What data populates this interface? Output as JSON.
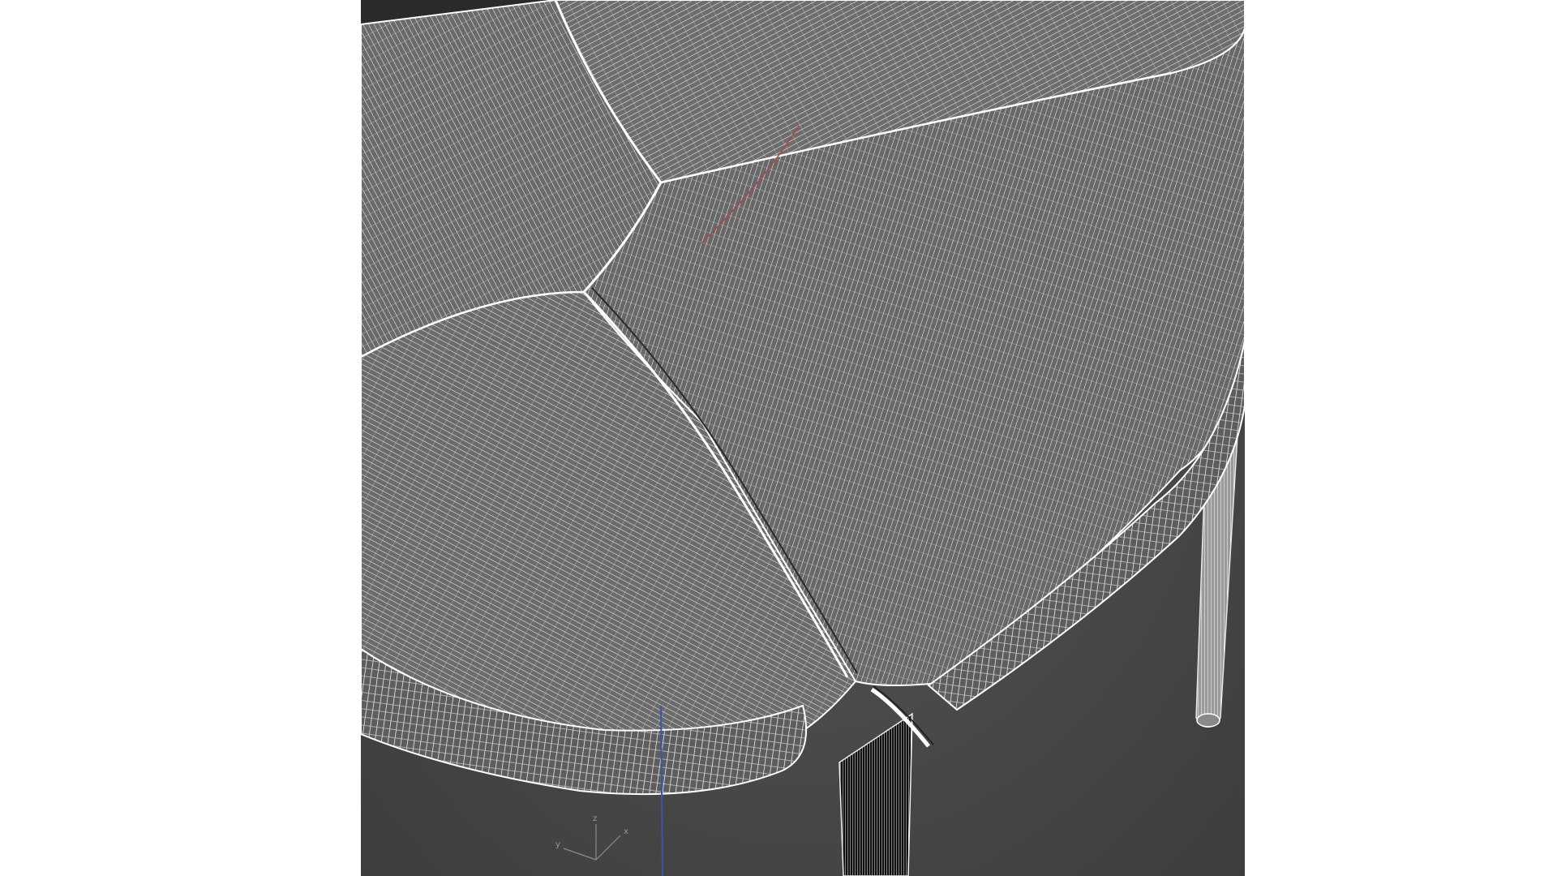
{
  "viewport": {
    "shading_mode": "wireframe",
    "background_color": "#4a4a4a",
    "wire_color": "#ffffff",
    "mesh_fill_color": "#6b6b6b",
    "selected_edge_color": "#ffffff",
    "object": "seat-cushion-with-legs"
  },
  "gizmo": {
    "x_label": "x",
    "y_label": "y",
    "z_label": "z",
    "x_color": "#c04040",
    "y_color": "#40a040",
    "z_color": "#4060c0"
  },
  "view_cube_axes": {
    "x_label": "x",
    "y_label": "y",
    "z_label": "z"
  }
}
